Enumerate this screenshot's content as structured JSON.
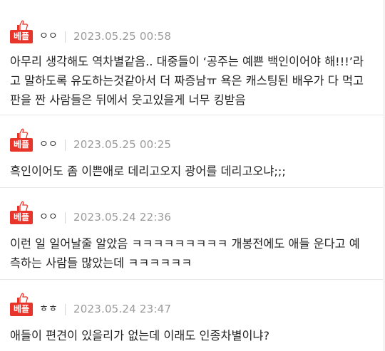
{
  "comments": [
    {
      "badge": "베플",
      "nick": "ㅇㅇ",
      "date": "2023.05.25 00:58",
      "lines": [
        "아무리 생각해도 역차별같음.. 대중들이 ‘공주는 예쁜 백인이어야 해!!!’라",
        "고 말하도록 유도하는것같아서 더 짜증남ㅠ 욕은 캐스팅된 배우가 다 먹고",
        "판을 짠 사람들은 뒤에서 웃고있을게 너무 킹받음"
      ]
    },
    {
      "badge": "베플",
      "nick": "ㅇㅇ",
      "date": "2023.05.25 00:25",
      "lines": [
        "흑인이어도 좀 이쁜애로 데리고오지 광어를 데리고오냐;;;"
      ]
    },
    {
      "badge": "베플",
      "nick": "ㅇㅇ",
      "date": "2023.05.24 22:36",
      "lines": [
        "이런 일 일어날줄 알았음 ㅋㅋㅋㅋㅋㅋㅋㅋㅋ 개봉전에도 애들 운다고 예",
        "측하는 사람들 많았는데 ㅋㅋㅋㅋㅋㅋ"
      ]
    },
    {
      "badge": "베플",
      "nick": "ㅎㅎ",
      "date": "2023.05.24 23:47",
      "lines": [
        "애들이 편견이 있을리가 없는데 이래도 인종차별이냐?"
      ]
    }
  ],
  "colors": {
    "best_badge": "#e8352b",
    "date": "#9a9a9a",
    "divider": "#e6e6e6"
  },
  "icons": {
    "badge_icon": "thumbs-up-icon"
  }
}
